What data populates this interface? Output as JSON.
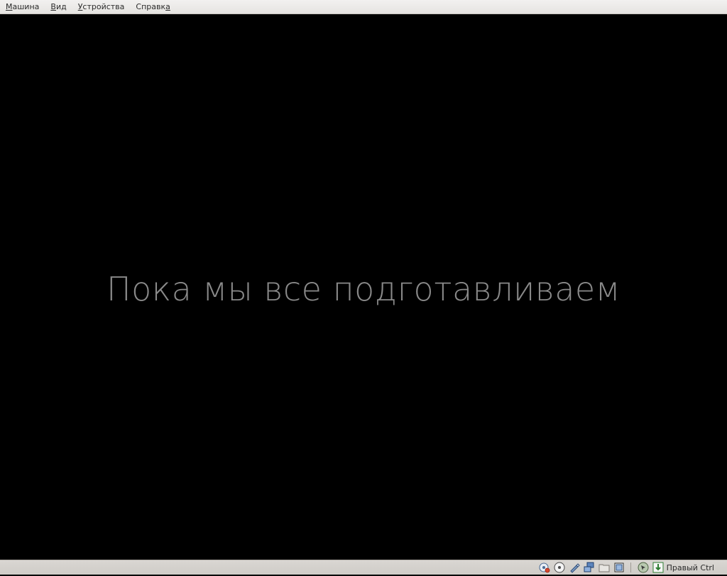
{
  "menubar": {
    "items": [
      {
        "accel": "М",
        "rest": "ашина"
      },
      {
        "accel": "В",
        "rest": "ид"
      },
      {
        "accel": "У",
        "rest": "стройства"
      },
      {
        "accel": "",
        "rest": "Справк",
        "tail": "а"
      }
    ]
  },
  "screen": {
    "message": "Пока мы все подготавливаем"
  },
  "statusbar": {
    "icons": [
      "hard-disk-icon",
      "optical-drive-icon",
      "usb-icon",
      "network-icon",
      "shared-folders-icon",
      "video-capture-icon",
      "mouse-integration-icon",
      "keyboard-capture-icon"
    ],
    "host_key": "Правый Ctrl"
  }
}
